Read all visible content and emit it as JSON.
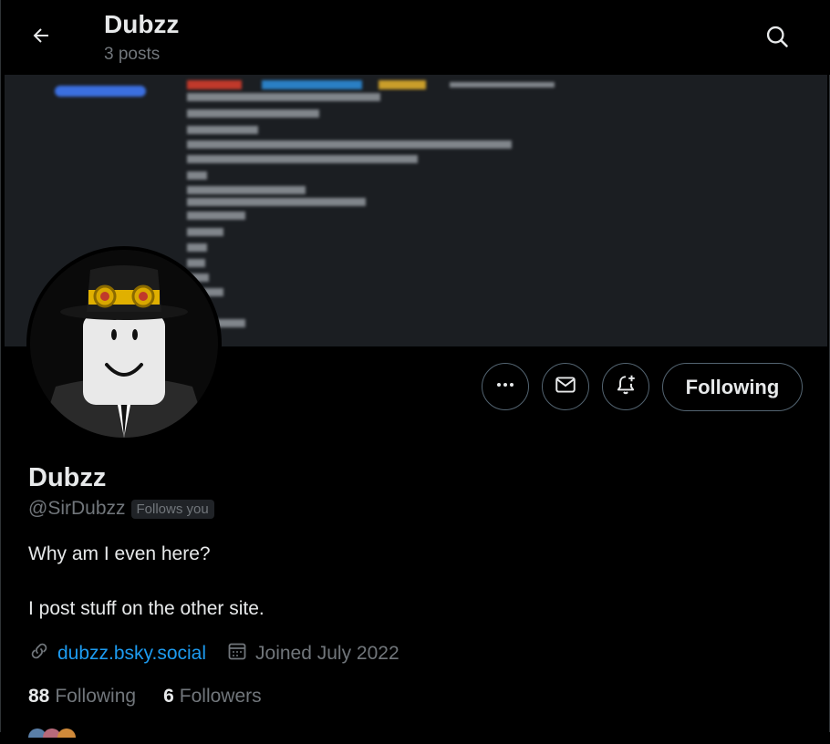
{
  "header": {
    "back_icon": "arrow-left-icon",
    "title": "Dubzz",
    "post_count": "3 posts",
    "search_icon": "search-icon"
  },
  "profile": {
    "display_name": "Dubzz",
    "handle": "@SirDubzz",
    "follows_you_badge": "Follows you",
    "bio_line_1": "Why am I even here?",
    "bio_line_2": "I post stuff on the other site.",
    "website": "dubzz.bsky.social",
    "joined": "Joined July 2022",
    "following_count": "88",
    "following_label": "Following",
    "followers_count": "6",
    "followers_label": "Followers"
  },
  "actions": {
    "more_icon": "ellipsis-icon",
    "message_icon": "envelope-icon",
    "notify_icon": "bell-plus-icon",
    "follow_state_label": "Following"
  },
  "colors": {
    "background": "#000000",
    "text_primary": "#e7e9ea",
    "text_secondary": "#71767b",
    "link": "#1d9bf0",
    "border": "#536471"
  }
}
